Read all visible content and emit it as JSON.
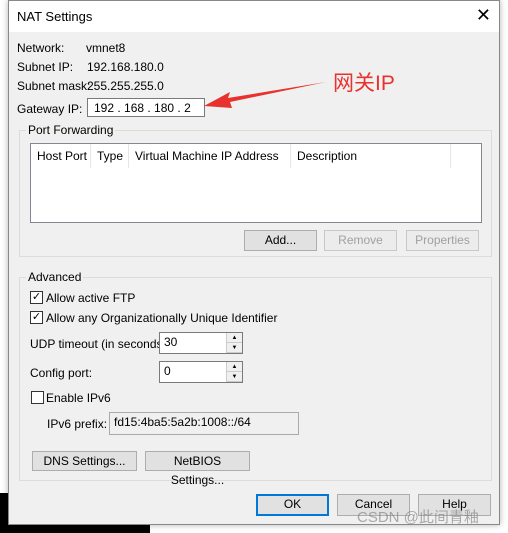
{
  "dialog": {
    "title": "NAT Settings",
    "close_icon": "close-icon"
  },
  "info": {
    "network_label": "Network:",
    "network_value": "vmnet8",
    "subnet_ip_label": "Subnet IP:",
    "subnet_ip_value": "192.168.180.0",
    "subnet_mask_label": "Subnet mask:",
    "subnet_mask_value": "255.255.255.0",
    "gateway_label": "Gateway IP:",
    "gateway_value": "192 . 168 . 180 .  2"
  },
  "annotation": {
    "text": "网关IP",
    "color": "#e8322d"
  },
  "port_forwarding": {
    "title": "Port Forwarding",
    "columns": [
      "Host Port",
      "Type",
      "Virtual Machine IP Address",
      "Description"
    ],
    "add": "Add...",
    "remove": "Remove",
    "properties": "Properties"
  },
  "advanced": {
    "title": "Advanced",
    "allow_ftp": {
      "label": "Allow active FTP",
      "checked": true
    },
    "allow_oui": {
      "label": "Allow any Organizationally Unique Identifier",
      "checked": true
    },
    "udp_label": "UDP timeout (in seconds):",
    "udp_value": "30",
    "config_port_label": "Config port:",
    "config_port_value": "0",
    "enable_ipv6": {
      "label": "Enable IPv6",
      "checked": false
    },
    "ipv6_prefix_label": "IPv6 prefix:",
    "ipv6_prefix_value": "fd15:4ba5:5a2b:1008::/64",
    "dns": "DNS Settings...",
    "netbios": "NetBIOS Settings..."
  },
  "footer": {
    "ok": "OK",
    "cancel": "Cancel",
    "help": "Help"
  },
  "watermark": "CSDN @此间青釉"
}
